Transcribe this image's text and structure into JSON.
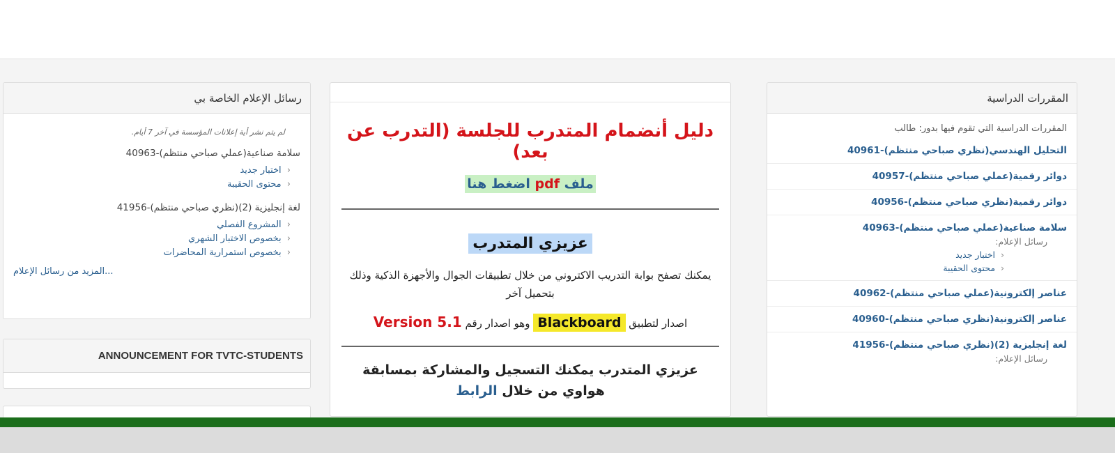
{
  "courses_panel": {
    "title": "المقررات الدراسية",
    "intro": "المقررات الدراسية التي تقوم فيها بدور: طالب",
    "items": [
      {
        "label": "التحليل الهندسي(نظري صباحي منتظم)-40961"
      },
      {
        "label": "دوائر رقمية(عملي صباحي منتظم)-40957"
      },
      {
        "label": "دوائر رقمية(نظري صباحي منتظم)-40956"
      },
      {
        "label": "سلامة صناعية(عملي صباحي منتظم)-40963",
        "sub_label": "رسائل الإعلام:",
        "links": [
          "اختبار جديد",
          "محتوى الحقيبة"
        ]
      },
      {
        "label": "عناصر إلكترونية(عملي صباحي منتظم)-40962"
      },
      {
        "label": "عناصر إلكترونية(نظري صباحي منتظم)-40960"
      },
      {
        "label": "لغة إنجليزية (2)(نظري صباحي منتظم)-41956",
        "sub_label": "رسائل الإعلام:"
      }
    ]
  },
  "main_panel": {
    "title": "دليل أنضمام المتدرب للجلسة (التدرب عن بعد)",
    "pdf_file": "ملف",
    "pdf_word": "pdf",
    "pdf_click": "اضغط هنا",
    "dear_trainee": "عزيزي المتدرب",
    "browse_text": "يمكنك تصفح بوابة التدريب الاكتروني من خلال تطبيقات الجوال والأجهزة الذكية وذلك بتحميل آخر",
    "version_prefix": "اصدار لتطبيق",
    "blackboard": "Blackboard",
    "version_middle": "وهو اصدار رقم",
    "version_number": "Version 5.1",
    "competition_text": "عزيزي المتدرب يمكنك التسجيل والمشاركة بمسابقة هواوي من خلال",
    "competition_link": "الرابط"
  },
  "media_panel": {
    "title": "رسائل الإعلام الخاصة بي",
    "note": "لم يتم نشر أية إعلانات المؤسسة في آخر 7 أيام.",
    "groups": [
      {
        "course": "سلامة صناعية(عملي صباحي منتظم)-40963",
        "links": [
          "اختبار جديد",
          "محتوى الحقيبة"
        ]
      },
      {
        "course": "لغة إنجليزية (2)(نظري صباحي منتظم)-41956",
        "links": [
          "المشروع الفصلي",
          "بخصوص الاختبار الشهري",
          "بخصوص استمرارية المحاضرات"
        ]
      }
    ],
    "more": "المزيد من رسائل الإعلام..."
  },
  "announcement_panel": {
    "title": "ANNOUNCEMENT FOR TVTC-STUDENTS"
  },
  "colors": {
    "accent_red": "#d4141a",
    "link_blue": "#2a5f8f",
    "highlight_green": "#c9f0c4",
    "highlight_blue": "#bcd8f7",
    "highlight_yellow": "#f5e82a",
    "footer_green": "#1b6e1b"
  }
}
